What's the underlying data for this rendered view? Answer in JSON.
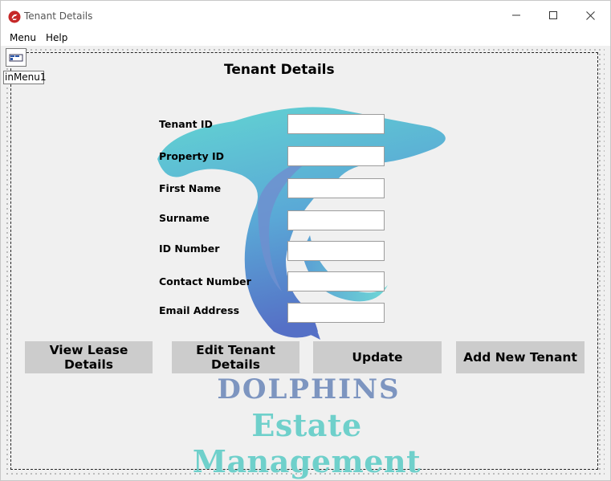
{
  "window": {
    "title": "Tenant Details",
    "minimize_icon": "minimize-icon",
    "maximize_icon": "maximize-icon",
    "close_icon": "close-icon"
  },
  "menubar": {
    "items": [
      {
        "label": "Menu"
      },
      {
        "label": "Help"
      }
    ]
  },
  "designer": {
    "menu_component_label": "inMenu1",
    "menu_component_icon": "main-menu-component-icon"
  },
  "form": {
    "title": "Tenant Details",
    "fields": [
      {
        "label": "Tenant ID",
        "value": ""
      },
      {
        "label": "Property ID",
        "value": ""
      },
      {
        "label": "First Name",
        "value": ""
      },
      {
        "label": "Surname",
        "value": ""
      },
      {
        "label": "ID Number",
        "value": ""
      },
      {
        "label": "Contact Number",
        "value": ""
      },
      {
        "label": "Email Address",
        "value": ""
      }
    ],
    "buttons": [
      {
        "label": "View Lease Details"
      },
      {
        "label": "Edit Tenant Details"
      },
      {
        "label": "Update"
      },
      {
        "label": "Add New Tenant"
      }
    ]
  },
  "branding": {
    "line1": "DOLPHINS",
    "line2": "Estate Management",
    "colors": {
      "line1": "#7d95c0",
      "line2": "#6fd0cb",
      "dolphin_light": "#62d6d2",
      "dolphin_dark": "#5878c8"
    }
  }
}
